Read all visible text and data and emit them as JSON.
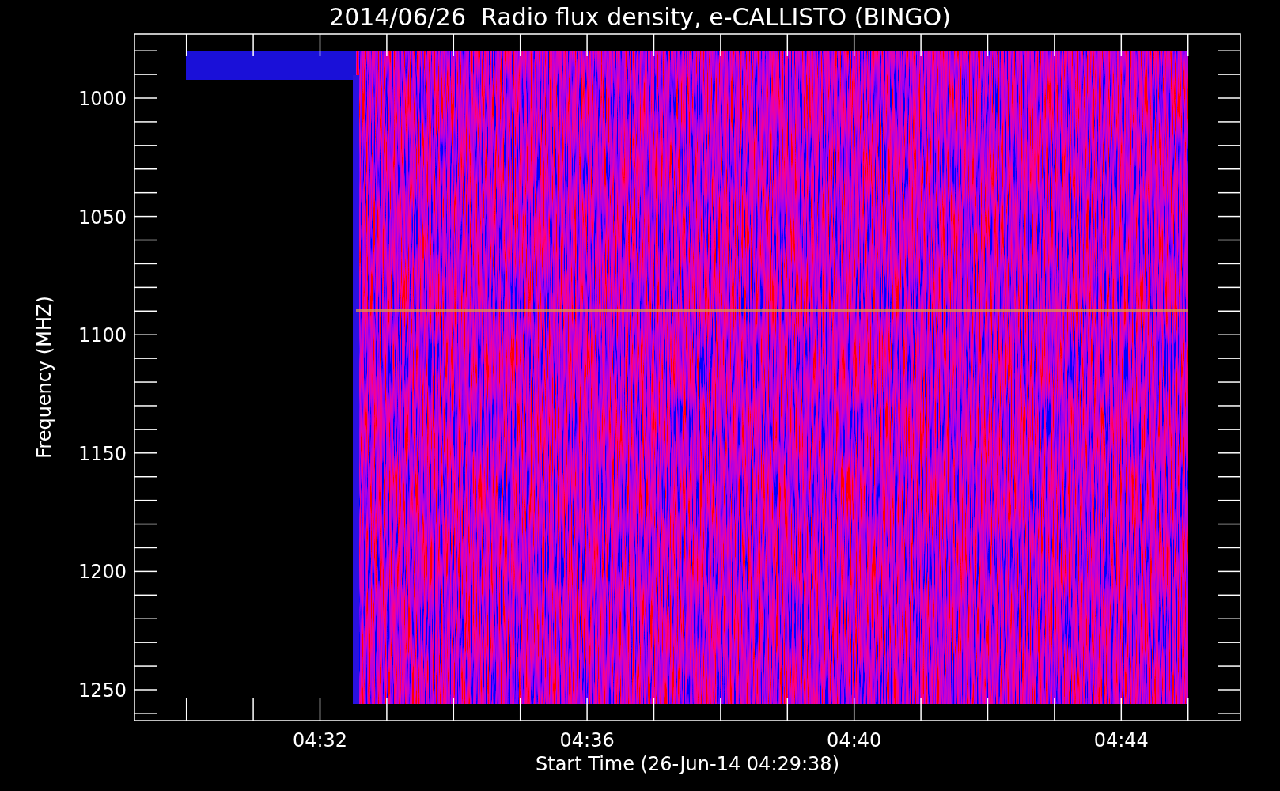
{
  "title": "2014/06/26  Radio flux density, e-CALLISTO (BINGO)",
  "plot": {
    "xlabel": "Start Time (26-Jun-14 04:29:38)",
    "ylabel": "Frequency (MHZ)",
    "xticks": [
      "04:32",
      "04:36",
      "04:40",
      "04:44"
    ],
    "yticks": [
      "1000",
      "1050",
      "1100",
      "1150",
      "1200",
      "1250"
    ]
  }
}
